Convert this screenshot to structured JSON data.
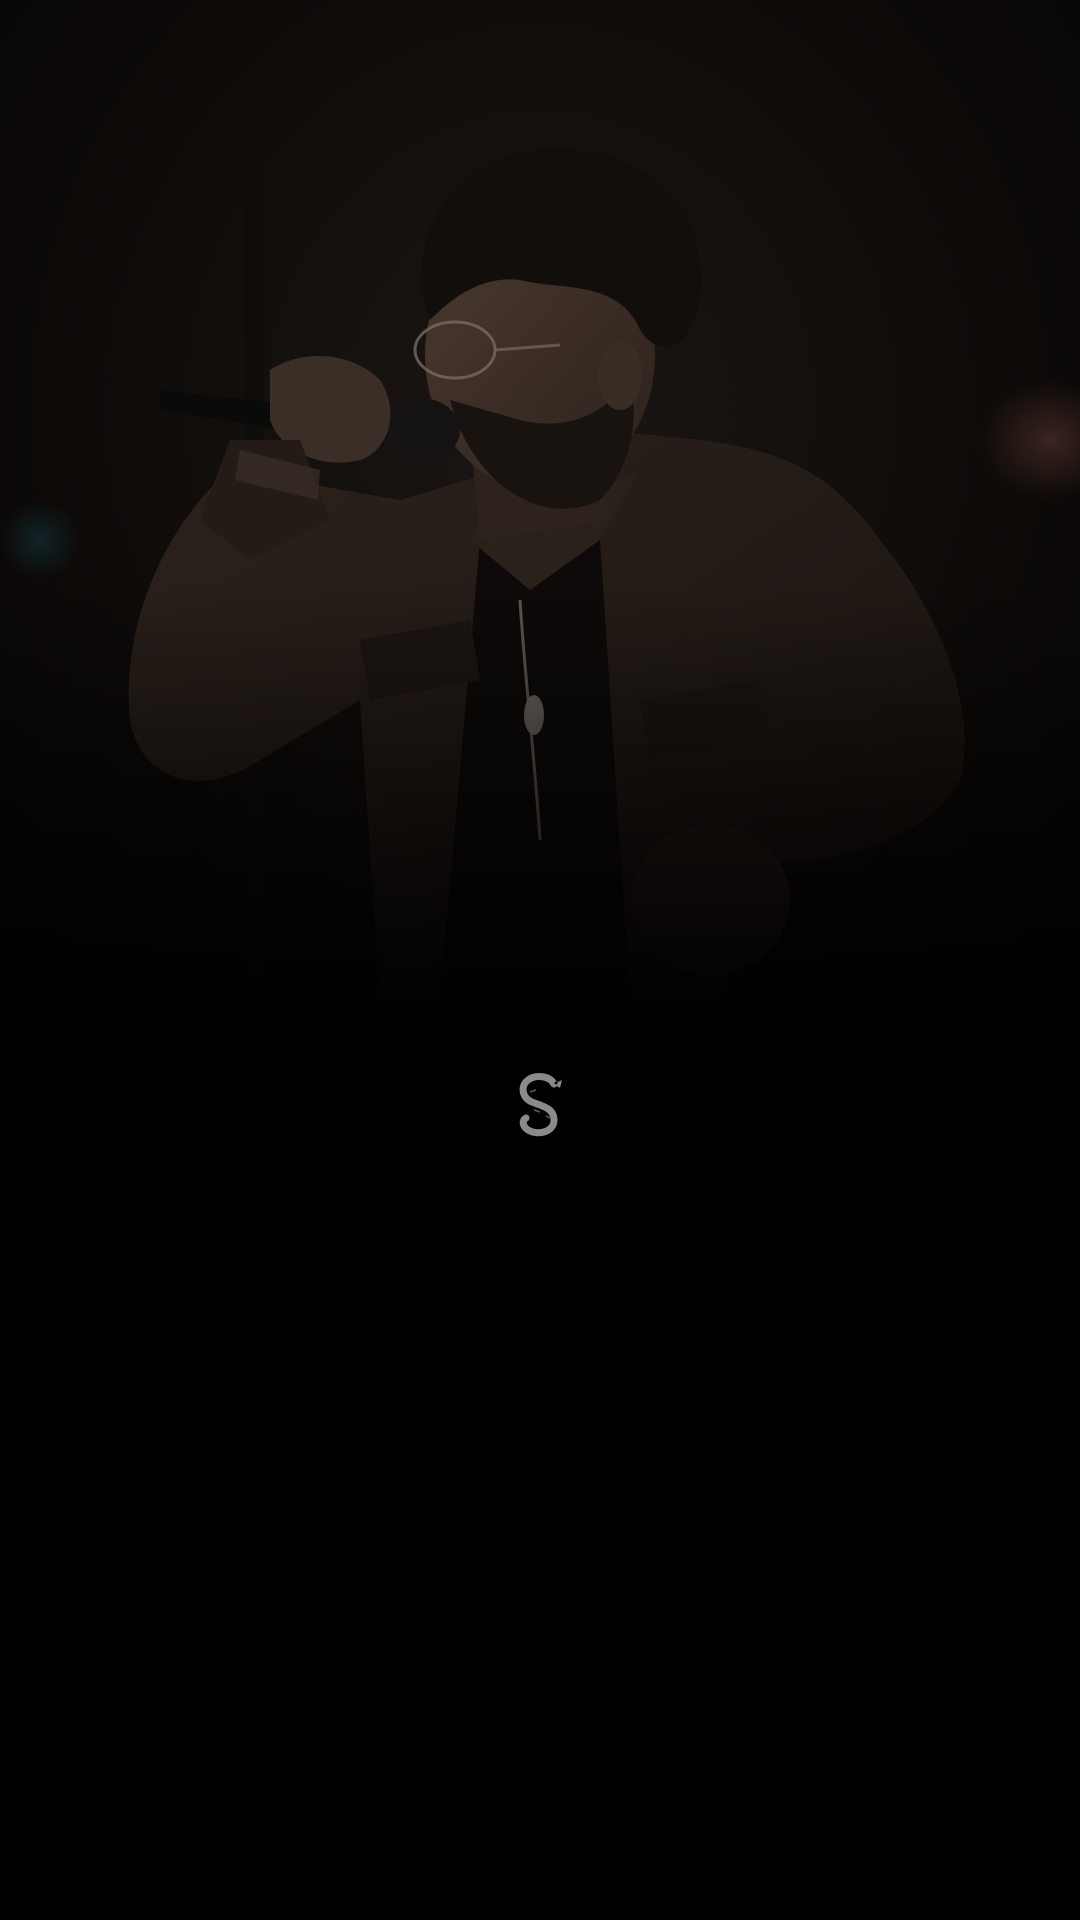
{
  "screen": {
    "background_color": "#000000"
  },
  "hero_image": {
    "subject": "singer-with-microphone",
    "tint_color": "#1a1410"
  },
  "logo": {
    "icon": "serpent-s-logo-icon",
    "color": "#8a8a8a"
  }
}
